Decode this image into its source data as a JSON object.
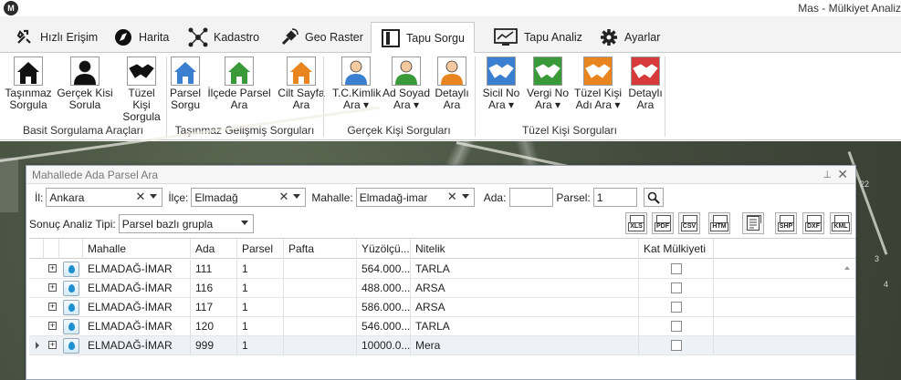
{
  "window": {
    "logo": "M",
    "title": "Mas - Mülkiyet Analiz"
  },
  "tabs": [
    {
      "label": "Hızlı Erişim",
      "icon": "tools-icon"
    },
    {
      "label": "Harita",
      "icon": "map-icon"
    },
    {
      "label": "Kadastro",
      "icon": "network-icon"
    },
    {
      "label": "Geo Raster",
      "icon": "satellite-icon"
    },
    {
      "label": "Tapu Sorgu",
      "icon": "book-icon",
      "active": true
    },
    {
      "label": "Tapu Analiz",
      "icon": "chart-monitor-icon"
    },
    {
      "label": "Ayarlar",
      "icon": "gear-icon"
    }
  ],
  "ribbon": {
    "groups": [
      {
        "label": "Basit Sorgulama Araçları"
      },
      {
        "label": "Taşınmaz Gelişmiş Sorguları"
      },
      {
        "label": "Gerçek Kişi Sorguları"
      },
      {
        "label": "Tüzel Kişi Sorguları"
      }
    ],
    "buttons": [
      {
        "label": "Taşınmaz\nSorgula",
        "icon": "house-icon",
        "color": "#111111"
      },
      {
        "label": "Gerçek Kisi\nSorula",
        "icon": "person-icon",
        "color": "#111111"
      },
      {
        "label": "Tüzel Kişi\nSorgula",
        "icon": "handshake-icon",
        "color": "#111111"
      },
      {
        "label": "Parsel\nSorgu",
        "icon": "house-icon",
        "color": "#3b7fd0"
      },
      {
        "label": "İlçede Parsel\nAra",
        "icon": "house-icon",
        "color": "#3a9a3a"
      },
      {
        "label": "Cilt Sayfa\nAra",
        "icon": "house-icon",
        "color": "#e8851e"
      },
      {
        "label": "T.C.Kimlik\nAra ▾",
        "icon": "person-icon",
        "color": "#3b7fd0"
      },
      {
        "label": "Ad Soyad\nAra ▾",
        "icon": "person-icon",
        "color": "#3a9a3a"
      },
      {
        "label": "Detaylı\nAra",
        "icon": "person-icon",
        "color": "#e8851e"
      },
      {
        "label": "Sicil No\nAra ▾",
        "icon": "handshake-icon",
        "color": "#3b7fd0"
      },
      {
        "label": "Vergi No\nAra ▾",
        "icon": "handshake-icon",
        "color": "#3a9a3a"
      },
      {
        "label": "Tüzel Kişi\nAdı Ara ▾",
        "icon": "handshake-icon",
        "color": "#e8851e"
      },
      {
        "label": "Detaylı\nAra",
        "icon": "handshake-icon",
        "color": "#d63a3a"
      }
    ]
  },
  "map": {
    "labels": [
      "22",
      "3",
      "4"
    ]
  },
  "dialog": {
    "title": "Mahallede Ada Parsel Ara",
    "pin": "⊥",
    "close": "✕",
    "il_label": "İl:",
    "il_value": "Ankara",
    "ilce_label": "İlçe:",
    "ilce_value": "Elmadağ",
    "mahalle_label": "Mahalle:",
    "mahalle_value": "Elmadağ-imar",
    "ada_label": "Ada:",
    "ada_value": "",
    "parsel_label": "Parsel:",
    "parsel_value": "1",
    "analiz_label": "Sonuç Analiz Tipi:",
    "analiz_value": "Parsel bazlı grupla",
    "export_buttons": [
      "XLS",
      "PDF",
      "CSV",
      "HTM",
      "",
      "SHP",
      "DXF",
      "KML"
    ]
  },
  "grid": {
    "columns": [
      "Mahalle",
      "Ada",
      "Parsel",
      "Pafta",
      "Yüzölçü...",
      "Nitelik",
      "Kat Mülkiyeti"
    ],
    "rows": [
      {
        "mahalle": "ELMADAĞ-İMAR",
        "ada": "111",
        "parsel": "1",
        "pafta": "",
        "yuzolcum": "564.000...",
        "nitelik": "TARLA",
        "kat": false
      },
      {
        "mahalle": "ELMADAĞ-İMAR",
        "ada": "116",
        "parsel": "1",
        "pafta": "",
        "yuzolcum": "488.000...",
        "nitelik": "ARSA",
        "kat": false
      },
      {
        "mahalle": "ELMADAĞ-İMAR",
        "ada": "117",
        "parsel": "1",
        "pafta": "",
        "yuzolcum": "586.000...",
        "nitelik": "ARSA",
        "kat": false
      },
      {
        "mahalle": "ELMADAĞ-İMAR",
        "ada": "120",
        "parsel": "1",
        "pafta": "",
        "yuzolcum": "546.000...",
        "nitelik": "TARLA",
        "kat": false
      },
      {
        "mahalle": "ELMADAĞ-İMAR",
        "ada": "999",
        "parsel": "1",
        "pafta": "",
        "yuzolcum": "10000.0...",
        "nitelik": "Mera",
        "kat": false
      }
    ]
  }
}
